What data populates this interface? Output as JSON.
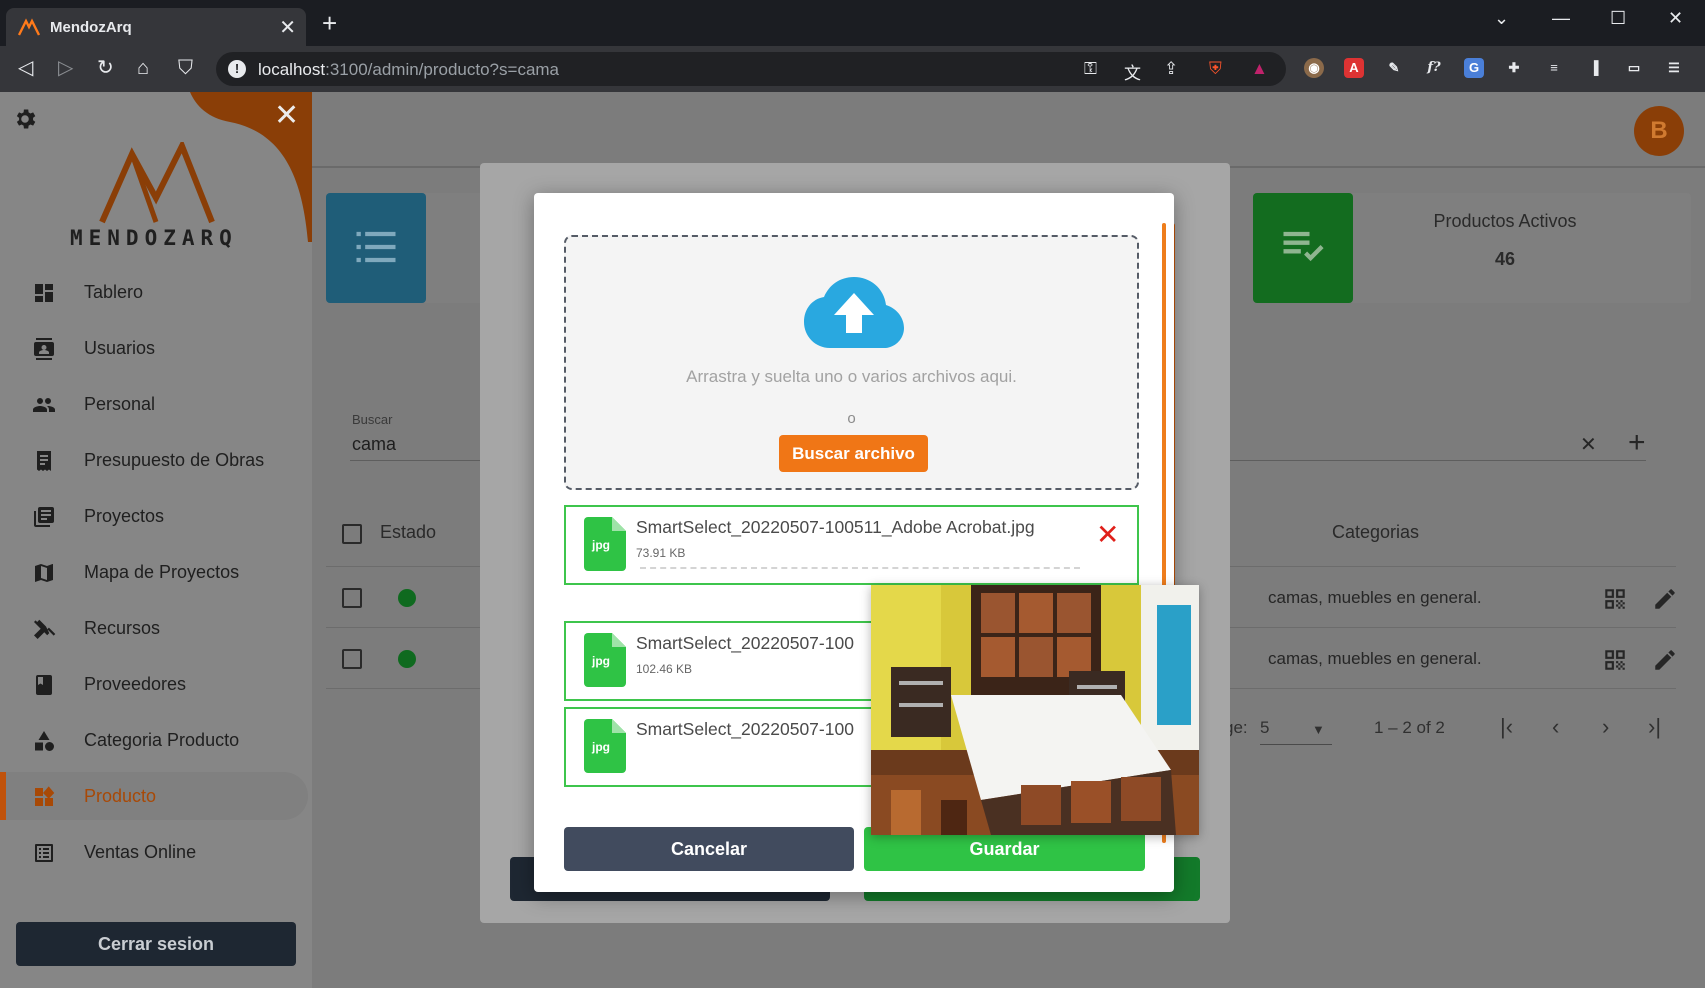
{
  "browser": {
    "tab_title": "MendozArq",
    "url_host": "localhost",
    "url_path": ":3100/admin/producto?s=cama"
  },
  "sidebar": {
    "brand": "MENDOZARQ",
    "items": [
      {
        "label": "Tablero",
        "icon": "dashboard-icon"
      },
      {
        "label": "Usuarios",
        "icon": "contacts-icon"
      },
      {
        "label": "Personal",
        "icon": "people-icon"
      },
      {
        "label": "Presupuesto de Obras",
        "icon": "receipt-icon"
      },
      {
        "label": "Proyectos",
        "icon": "library-icon"
      },
      {
        "label": "Mapa de Proyectos",
        "icon": "map-icon"
      },
      {
        "label": "Recursos",
        "icon": "tools-icon"
      },
      {
        "label": "Proveedores",
        "icon": "book-icon"
      },
      {
        "label": "Categoria Producto",
        "icon": "category-icon"
      },
      {
        "label": "Producto",
        "icon": "widgets-icon"
      },
      {
        "label": "Ventas Online",
        "icon": "list-alt-icon"
      }
    ],
    "active": "Producto",
    "logout": "Cerrar sesion"
  },
  "header": {
    "avatar_initial": "B"
  },
  "cards": {
    "active_products": {
      "title": "Productos Activos",
      "value": "46"
    }
  },
  "search": {
    "label": "Buscar",
    "value": "cama"
  },
  "table": {
    "col_status": "Estado",
    "col_categories": "Categorias",
    "rows": [
      {
        "categories": "camas, muebles en general."
      },
      {
        "categories": "camas, muebles en general."
      }
    ]
  },
  "pager": {
    "per_page_label": "ge:",
    "per_page": "5",
    "range": "1 – 2 of 2"
  },
  "dialog": {
    "drop_text": "Arrastra y suelta uno o varios archivos aqui.",
    "or_text": "o",
    "browse": "Buscar archivo",
    "files": [
      {
        "name": "SmartSelect_20220507-100511_Adobe Acrobat.jpg",
        "size": "73.91 KB",
        "ext": "jpg"
      },
      {
        "name": "SmartSelect_20220507-100",
        "size": "102.46 KB",
        "ext": "jpg"
      },
      {
        "name": "SmartSelect_20220507-100",
        "size": "",
        "ext": "jpg"
      }
    ],
    "cancel": "Cancelar",
    "save": "Guardar"
  },
  "colors": {
    "accent": "#f07616",
    "brand_orange": "#c25509",
    "success": "#2fc345",
    "dark": "#414b5e"
  }
}
